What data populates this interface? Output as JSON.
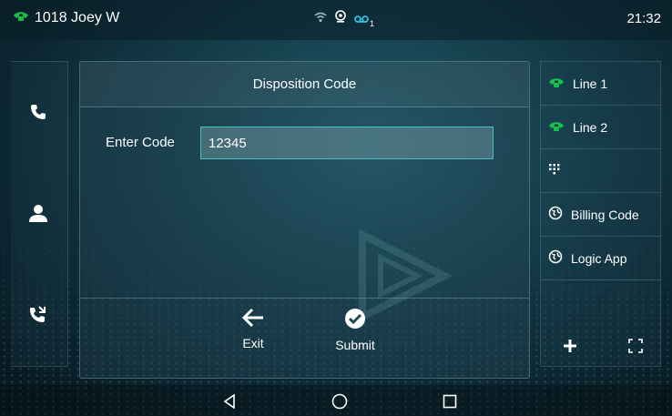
{
  "status_bar": {
    "account": "1018 Joey W",
    "voicemail_count": "1",
    "time": "21:32"
  },
  "dialog": {
    "title": "Disposition Code",
    "field_label": "Enter Code",
    "field_value": "12345",
    "exit_label": "Exit",
    "submit_label": "Submit"
  },
  "right_panel": {
    "items": [
      {
        "label": "Line 1",
        "icon": "phone-icon"
      },
      {
        "label": "Line 2",
        "icon": "phone-icon"
      },
      {
        "label": "",
        "icon": "dialpad-icon"
      },
      {
        "label": "Billing Code",
        "icon": "globe-icon"
      },
      {
        "label": "Logic App",
        "icon": "globe-icon"
      }
    ]
  },
  "colors": {
    "line_green": "#17c04a",
    "input_border": "#47c1c1"
  }
}
